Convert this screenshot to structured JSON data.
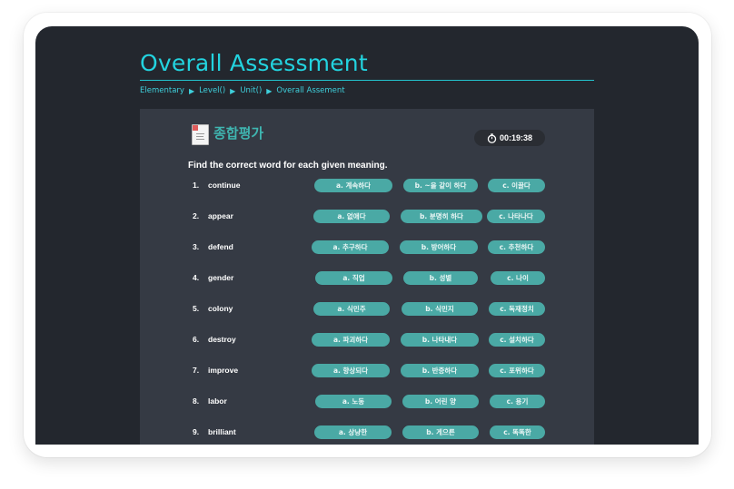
{
  "header": {
    "title": "Overall Assessment",
    "breadcrumb": [
      "Elementary",
      "Level()",
      "Unit()",
      "Overall Assement"
    ],
    "breadcrumb_separator": "▶"
  },
  "panel": {
    "title": "종합평가",
    "timer": "00:19:38",
    "instruction": "Find the correct word for each given meaning."
  },
  "questions": [
    {
      "num": "1.",
      "word": "continue",
      "options": [
        "a. 계속하다",
        "b. ~을 같이 하다",
        "c. 이끌다"
      ]
    },
    {
      "num": "2.",
      "word": "appear",
      "options": [
        "a. 없애다",
        "b. 분명히 하다",
        "c. 나타나다"
      ]
    },
    {
      "num": "3.",
      "word": "defend",
      "options": [
        "a. 추구하다",
        "b. 방어하다",
        "c. 추천하다"
      ]
    },
    {
      "num": "4.",
      "word": "gender",
      "options": [
        "a. 직업",
        "b. 성별",
        "c. 나이"
      ]
    },
    {
      "num": "5.",
      "word": "colony",
      "options": [
        "a. 식민주",
        "b. 식민지",
        "c. 독재정치"
      ]
    },
    {
      "num": "6.",
      "word": "destroy",
      "options": [
        "a. 파괴하다",
        "b. 나타내다",
        "c. 설치하다"
      ]
    },
    {
      "num": "7.",
      "word": "improve",
      "options": [
        "a. 향상되다",
        "b. 반증하다",
        "c. 포위하다"
      ]
    },
    {
      "num": "8.",
      "word": "labor",
      "options": [
        "a. 노동",
        "b. 어린 양",
        "c. 용기"
      ]
    },
    {
      "num": "9.",
      "word": "brilliant",
      "options": [
        "a. 상냥한",
        "b. 게으른",
        "c. 똑똑한"
      ]
    }
  ]
}
